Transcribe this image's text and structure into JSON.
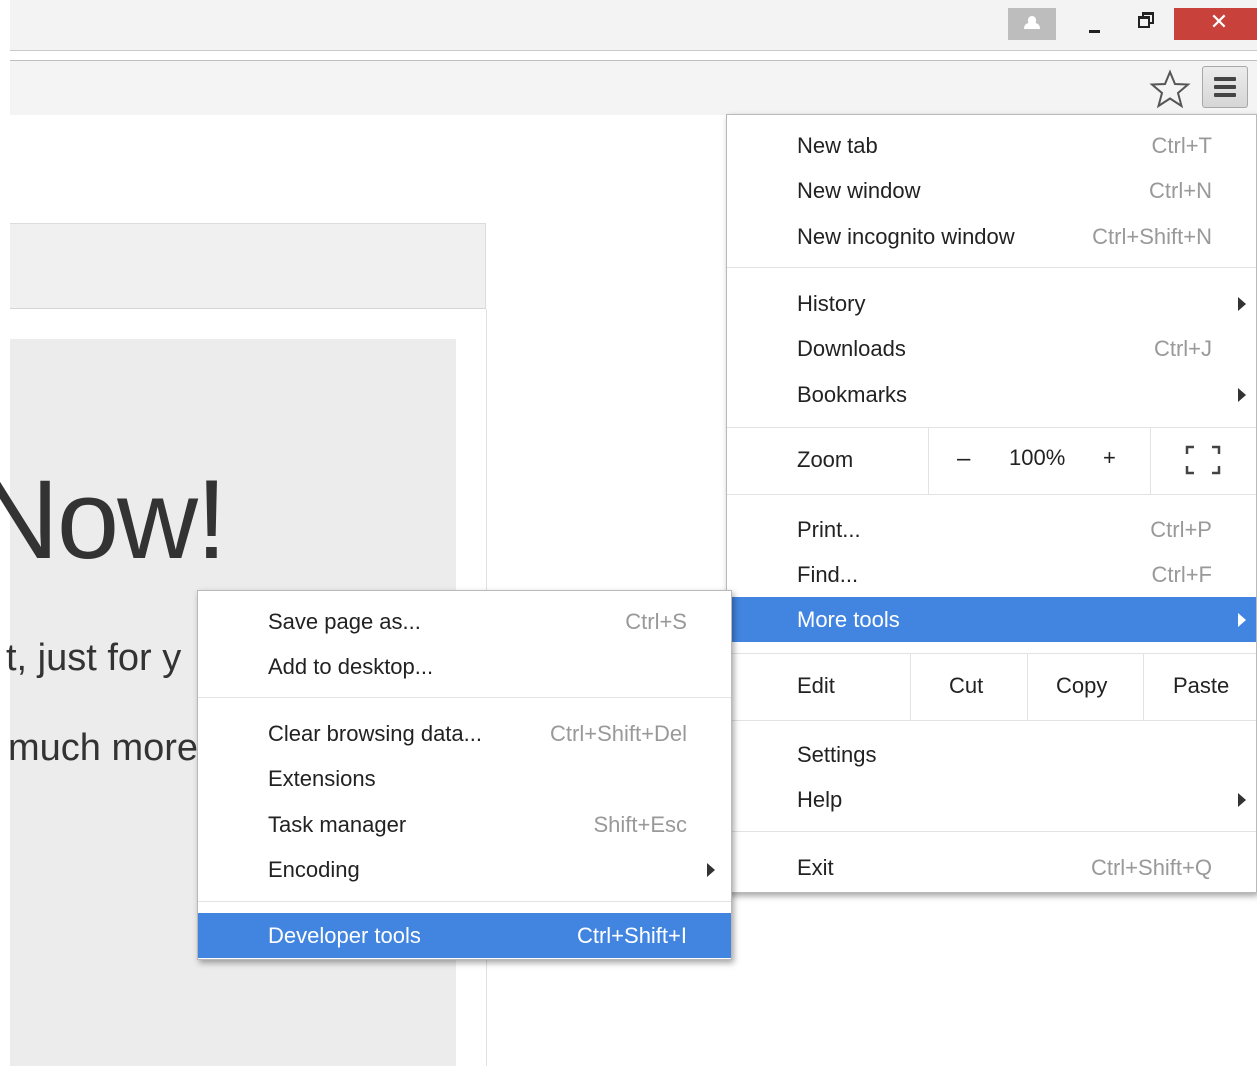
{
  "page": {
    "hero_title": "Now!",
    "hero_line1": "t, just for y",
    "hero_line2": "much more"
  },
  "main_menu": {
    "items": [
      {
        "label": "New tab",
        "shortcut": "Ctrl+T"
      },
      {
        "label": "New window",
        "shortcut": "Ctrl+N"
      },
      {
        "label": "New incognito window",
        "shortcut": "Ctrl+Shift+N"
      },
      {
        "label": "History",
        "shortcut": ""
      },
      {
        "label": "Downloads",
        "shortcut": "Ctrl+J"
      },
      {
        "label": "Bookmarks",
        "shortcut": ""
      },
      {
        "label": "Print...",
        "shortcut": "Ctrl+P"
      },
      {
        "label": "Find...",
        "shortcut": "Ctrl+F"
      },
      {
        "label": "More tools",
        "shortcut": ""
      },
      {
        "label": "Settings",
        "shortcut": ""
      },
      {
        "label": "Help",
        "shortcut": ""
      },
      {
        "label": "Exit",
        "shortcut": "Ctrl+Shift+Q"
      }
    ],
    "zoom": {
      "label": "Zoom",
      "minus": "–",
      "value": "100%",
      "plus": "+"
    },
    "edit": {
      "label": "Edit",
      "cut": "Cut",
      "copy": "Copy",
      "paste": "Paste"
    }
  },
  "sub_menu": {
    "items": [
      {
        "label": "Save page as...",
        "shortcut": "Ctrl+S"
      },
      {
        "label": "Add to desktop...",
        "shortcut": ""
      },
      {
        "label": "Clear browsing data...",
        "shortcut": "Ctrl+Shift+Del"
      },
      {
        "label": "Extensions",
        "shortcut": ""
      },
      {
        "label": "Task manager",
        "shortcut": "Shift+Esc"
      },
      {
        "label": "Encoding",
        "shortcut": ""
      },
      {
        "label": "Developer tools",
        "shortcut": "Ctrl+Shift+I"
      }
    ]
  },
  "window": {
    "close_glyph": "✕"
  },
  "colors": {
    "highlight": "#4285e0",
    "close": "#c9413b"
  }
}
